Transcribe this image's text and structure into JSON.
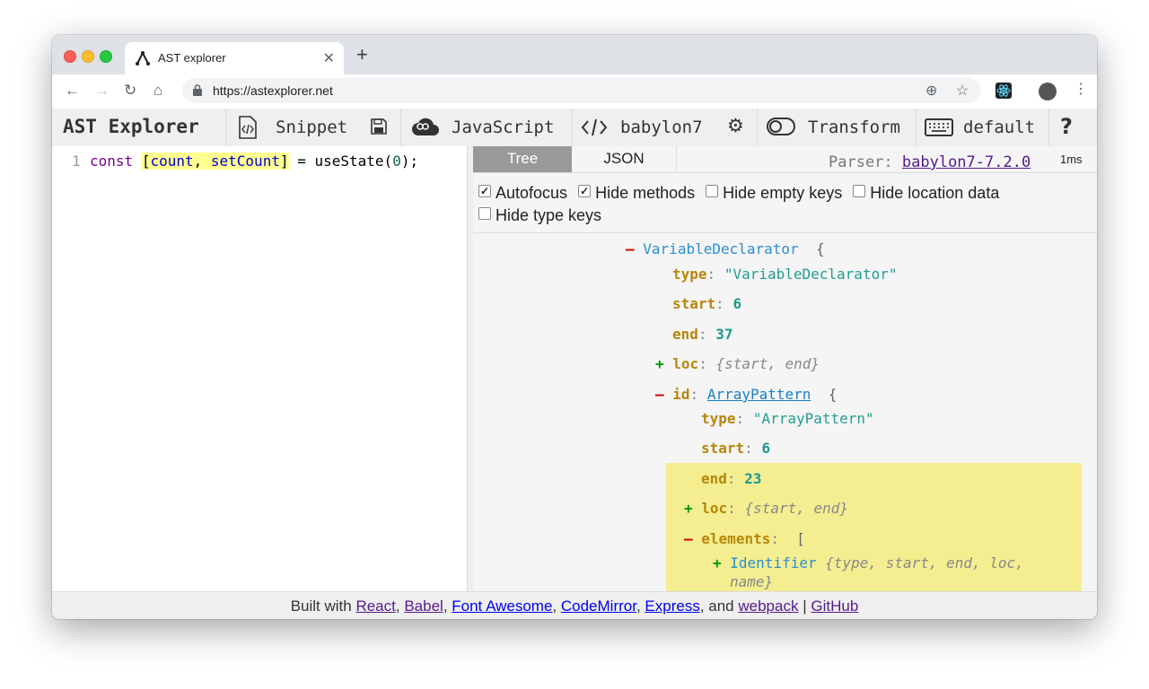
{
  "browser": {
    "tab_title": "AST explorer",
    "new_tab": "+",
    "url": "https://astexplorer.net"
  },
  "toolbar": {
    "app_title": "AST Explorer",
    "snippet_label": "Snippet",
    "language_label": "JavaScript",
    "parser_label": "babylon7",
    "transform_label": "Transform",
    "keymap_label": "default",
    "help_label": "?"
  },
  "editor": {
    "line_number": "1",
    "code": {
      "kw": "const",
      "open": "[",
      "var1": "count",
      "sep": ", ",
      "var2": "setCount",
      "close": "]",
      "rest": " = useState(",
      "num": "0",
      "end": ");"
    }
  },
  "output": {
    "tab_tree": "Tree",
    "tab_json": "JSON",
    "parser_prefix": "Parser: ",
    "parser_version": "babylon7-7.2.0",
    "parse_time": "1ms",
    "options": [
      {
        "label": "Autofocus",
        "checked": true
      },
      {
        "label": "Hide methods",
        "checked": true
      },
      {
        "label": "Hide empty keys",
        "checked": false
      },
      {
        "label": "Hide location data",
        "checked": false
      },
      {
        "label": "Hide type keys",
        "checked": false
      }
    ],
    "tree": {
      "root_name": "VariableDeclarator",
      "type_key": "type",
      "type_val": "\"VariableDeclarator\"",
      "start_key": "start",
      "start_val": "6",
      "end_key": "end",
      "end_val": "37",
      "loc_key": "loc",
      "loc_summary": "{start, end}",
      "id_key": "id",
      "id_name": "ArrayPattern",
      "id_type_val": "\"ArrayPattern\"",
      "id_start_val": "6",
      "id_end_val": "23",
      "elements_key": "elements",
      "elements_bracket": "[",
      "el_name": "Identifier",
      "el_summary_1": "{type, start, end, loc,",
      "el_summary_2": "name}",
      "minus": "–",
      "plus": "+",
      "colon": ":",
      "brace_open": "{"
    }
  },
  "footer": {
    "built_with": "Built with ",
    "react": "React",
    "babel": "Babel",
    "font_awesome": "Font Awesome",
    "codemirror": "CodeMirror",
    "express": "Express",
    "and": ", and ",
    "webpack": "webpack",
    "github": "GitHub",
    "comma": ", ",
    "pipe": " | "
  }
}
